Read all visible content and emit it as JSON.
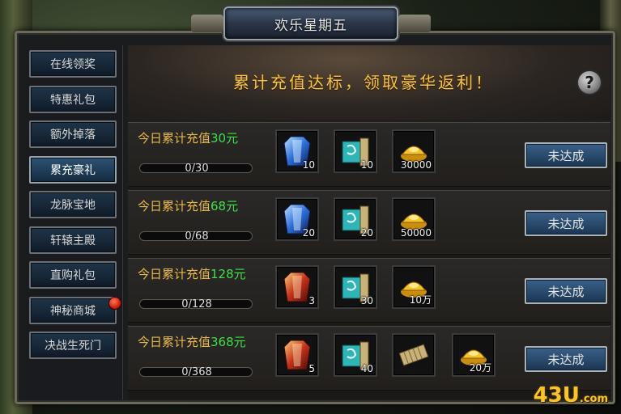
{
  "header": {
    "title": "欢乐星期五"
  },
  "sidebar": {
    "items": [
      {
        "label": "在线领奖",
        "active": false
      },
      {
        "label": "特惠礼包",
        "active": false
      },
      {
        "label": "额外掉落",
        "active": false
      },
      {
        "label": "累充豪礼",
        "active": true
      },
      {
        "label": "龙脉宝地",
        "active": false
      },
      {
        "label": "轩辕主殿",
        "active": false
      },
      {
        "label": "直购礼包",
        "active": false
      },
      {
        "label": "神秘商城",
        "active": false,
        "badge": true
      },
      {
        "label": "决战生死门",
        "active": false
      }
    ]
  },
  "banner": {
    "text": "累计充值达标，领取豪华返利！",
    "help": "?"
  },
  "rows": [
    {
      "prefix": "今日累计充值",
      "amount": "30元",
      "progress": "0/30",
      "progress_fraction": 0,
      "items": [
        {
          "icon": "blue-armor-icon",
          "qty": "10"
        },
        {
          "icon": "jade-scroll-icon",
          "qty": "10"
        },
        {
          "icon": "gold-ingot-icon",
          "qty": "30000"
        }
      ],
      "status": "未达成"
    },
    {
      "prefix": "今日累计充值",
      "amount": "68元",
      "progress": "0/68",
      "progress_fraction": 0,
      "items": [
        {
          "icon": "blue-armor-icon",
          "qty": "20"
        },
        {
          "icon": "jade-scroll-icon",
          "qty": "20"
        },
        {
          "icon": "gold-ingot-icon",
          "qty": "50000"
        }
      ],
      "status": "未达成"
    },
    {
      "prefix": "今日累计充值",
      "amount": "128元",
      "progress": "0/128",
      "progress_fraction": 0,
      "items": [
        {
          "icon": "red-armor-icon",
          "qty": "3"
        },
        {
          "icon": "jade-scroll-icon",
          "qty": "30"
        },
        {
          "icon": "gold-ingot-icon",
          "qty": "10万"
        }
      ],
      "status": "未达成"
    },
    {
      "prefix": "今日累计充值",
      "amount": "368元",
      "progress": "0/368",
      "progress_fraction": 0,
      "items": [
        {
          "icon": "red-armor-icon",
          "qty": "5"
        },
        {
          "icon": "jade-scroll-icon",
          "qty": "40"
        },
        {
          "icon": "bamboo-scroll-icon",
          "qty": ""
        },
        {
          "icon": "gold-ingot-icon",
          "qty": "20万"
        }
      ],
      "status": "未达成"
    }
  ],
  "watermark": {
    "main": "43U",
    "suffix": ".com"
  },
  "colors": {
    "accent_gold": "#e6b94a",
    "amount_green": "#3ee04a",
    "banner_gold": "#f1c451"
  }
}
